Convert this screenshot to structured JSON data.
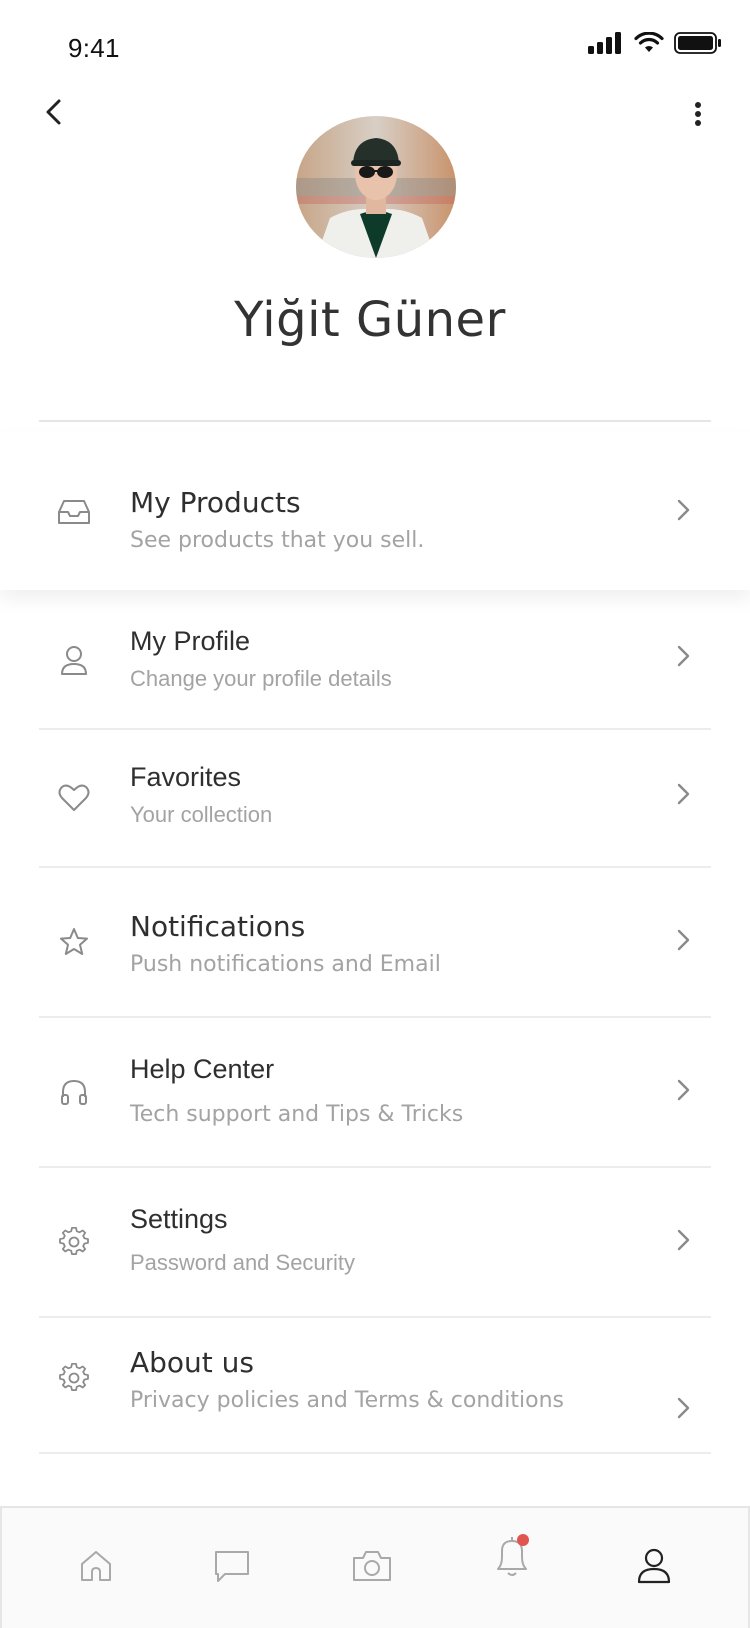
{
  "status_bar": {
    "time": "9:41"
  },
  "profile": {
    "name": "Yiğit Güner"
  },
  "menu": [
    {
      "title": "My Products",
      "subtitle": "See products that you sell.",
      "icon": "inbox-icon"
    },
    {
      "title": "My Profile",
      "subtitle": "Change your profile details",
      "icon": "user-icon"
    },
    {
      "title": "Favorites",
      "subtitle": "Your collection",
      "icon": "heart-icon"
    },
    {
      "title": "Notifications",
      "subtitle": "Push notifications and Email",
      "icon": "star-icon"
    },
    {
      "title": "Help Center",
      "subtitle": "Tech support and Tips & Tricks",
      "icon": "headphones-icon"
    },
    {
      "title": "Settings",
      "subtitle": "Password and Security",
      "icon": "gear-icon"
    },
    {
      "title": "About us",
      "subtitle": "Privacy policies and Terms & conditions",
      "icon": "gear-icon"
    }
  ],
  "tabbar": {
    "tabs": [
      "home-icon",
      "chat-icon",
      "camera-icon",
      "bell-icon",
      "user-icon"
    ],
    "active": "user-icon",
    "notification_dot_color": "#e0564f"
  },
  "colors": {
    "text_primary": "#2f2f2f",
    "text_secondary": "#a3a3a3",
    "icon": "#8a8a8a",
    "active_icon": "#222222"
  }
}
